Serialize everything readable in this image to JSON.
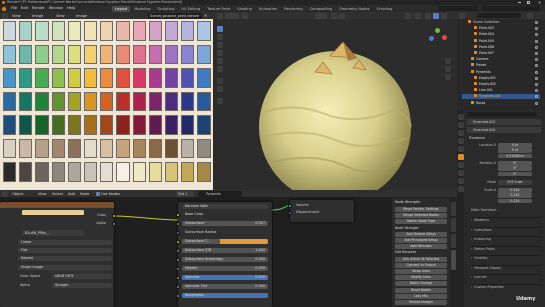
{
  "titlebar": {
    "title": "Blender* [PC Professional\\PC Content Works\\Concave\\Miniature Egyptian Planet\\Miniature Egyptian Planet.blend]"
  },
  "menu": {
    "items": [
      "File",
      "Edit",
      "Render",
      "Window",
      "Help"
    ]
  },
  "workspace_tabs": {
    "items": [
      "Layout",
      "Modeling",
      "Sculpting",
      "UV Editing",
      "Texture Paint",
      "Shading",
      "Animation",
      "Rendering",
      "Compositing",
      "Geometry Nodes",
      "Scripting"
    ],
    "active_index": 0
  },
  "image_editor": {
    "header": {
      "view": "View",
      "image": "Image",
      "view2": "View",
      "image_name": "Sunset_gouache_paint_texture"
    },
    "swatch_colors": [
      [
        "#c9d9df",
        "#a7d0c6",
        "#b9ddc9",
        "#cfe3bf",
        "#e8eab8",
        "#f2e3b3",
        "#f1d2b0",
        "#ecb7ab",
        "#e7a7b6",
        "#d3a4c8",
        "#c2a9d7",
        "#b4b5df",
        "#a9c7e4"
      ],
      [
        "#8ec3d9",
        "#6fb7aa",
        "#8fcd8f",
        "#b2d68b",
        "#ddde7c",
        "#f2d071",
        "#f1b276",
        "#e98b78",
        "#e07291",
        "#c56fae",
        "#9f73c2",
        "#8885cd",
        "#7aa6d8"
      ],
      [
        "#4a95c7",
        "#2e9a86",
        "#46ad55",
        "#8bc14c",
        "#cfcd3e",
        "#f2bb38",
        "#ee8a3c",
        "#e0513e",
        "#d63964",
        "#a83b8f",
        "#7342a5",
        "#5152af",
        "#3f7bc4"
      ],
      [
        "#2a6aa0",
        "#167566",
        "#1f843a",
        "#5f952c",
        "#a8a224",
        "#d99523",
        "#d46322",
        "#b8302a",
        "#ac224a",
        "#7c246d",
        "#4e2d80",
        "#2f3888",
        "#275a9c"
      ],
      [
        "#1f4d7a",
        "#0f574b",
        "#15622b",
        "#446d20",
        "#7c771b",
        "#a86e1a",
        "#a2481a",
        "#8a221f",
        "#831938",
        "#5d1b52",
        "#3a2161",
        "#222a66",
        "#1c4276"
      ],
      [
        "#d8cfc4",
        "#c9b9a6",
        "#b5a08a",
        "#a2876f",
        "#8d705a",
        "#e6dbc8",
        "#d6c0a0",
        "#c3a47b",
        "#a8865d",
        "#8a6a46",
        "#6c5235",
        "#b8b2a8",
        "#8f8a82"
      ],
      [
        "#2c2a28",
        "#4a4642",
        "#6b6560",
        "#8c857e",
        "#aea69e",
        "#c9c2ba",
        "#e3ddd6",
        "#f4efe8",
        "#f0e9c8",
        "#e7da9e",
        "#d8c37a",
        "#c2a85b",
        "#a48a45"
      ]
    ]
  },
  "viewport": {
    "header": {
      "mode": "Object Mode",
      "view": "View",
      "select": "Select",
      "add": "Add",
      "object": "Object",
      "orientation": "Global"
    }
  },
  "node_editor": {
    "header": {
      "items": [
        "Object",
        "View",
        "Select",
        "Add",
        "Node"
      ],
      "use_nodes": "Use Nodes",
      "slot": "Slot 1",
      "material": "Pyramids"
    },
    "image_node": {
      "output_color": "Color",
      "output_alpha": "Alpha",
      "image_name": "81u4N_PPbs_..",
      "interp": "Linear",
      "proj": "Flat",
      "ext": "Repeat",
      "source": "Single Image",
      "cs_label": "Color Space",
      "cs_value": "sRGB OETF",
      "alpha_label": "Alpha",
      "alpha_value": "Straight"
    },
    "bsdf_node": {
      "subsurface_method": "Random Walk",
      "rows": [
        {
          "label": "Base Color",
          "value": "",
          "style": "socket"
        },
        {
          "label": "Subsurface",
          "value": "0.027",
          "style": "field"
        },
        {
          "label": "Subsurface Radius",
          "value": "",
          "style": "socket"
        },
        {
          "label": "Subsurface C...",
          "value": "",
          "style": "color"
        },
        {
          "label": "Subsurface IOR",
          "value": "1.400",
          "style": "field"
        },
        {
          "label": "Subsurface Anisotropy",
          "value": "0.000",
          "style": "field"
        },
        {
          "label": "Metallic",
          "value": "0.000",
          "style": "field"
        },
        {
          "label": "Specular",
          "value": "0.500",
          "style": "blue"
        },
        {
          "label": "Specular Tint",
          "value": "0.000",
          "style": "field"
        },
        {
          "label": "Roughness",
          "value": "",
          "style": "blue"
        }
      ]
    },
    "output_node": {
      "volume": "Volume",
      "displacement": "Displacement"
    },
    "node_wrangler": {
      "title": "Node Wrangler",
      "items": [
        "Bevel Render Settings",
        "Merge Selected Nodes",
        "Switch Node Type",
        "Node Wrangler",
        "Add Texture Setup",
        "Add Principled Setup",
        "Add Reroutes",
        "Edit Reroutes",
        "Link Active To Selected",
        "Connect to Output",
        "Swap Links",
        "Modify Links",
        "Batch Change",
        "Reset Nodes",
        "Lazy Mix",
        "Reload Images"
      ]
    }
  },
  "outliner": {
    "rows": [
      {
        "indent": 2,
        "label": "Scene Collection",
        "color": "#cfcfcf"
      },
      {
        "indent": 4,
        "label": "Point.003",
        "color": "#e6e6e6"
      },
      {
        "indent": 4,
        "label": "Point.004",
        "color": "#e6e6e6"
      },
      {
        "indent": 4,
        "label": "Point.005",
        "color": "#e6e6e6"
      },
      {
        "indent": 4,
        "label": "Point.006",
        "color": "#e6e6e6"
      },
      {
        "indent": 4,
        "label": "Point.007",
        "color": "#e6e6e6"
      },
      {
        "indent": 3,
        "label": "Camera",
        "color": "#e6e6e6"
      },
      {
        "indent": 3,
        "label": "Planet",
        "color": "#e6e6e6"
      },
      {
        "indent": 3,
        "label": "Pyramids",
        "color": "#e6e6e6"
      },
      {
        "indent": 4,
        "label": "Empty.001",
        "color": "#e6e6e6"
      },
      {
        "indent": 4,
        "label": "Empty.002",
        "color": "#e6e6e6"
      },
      {
        "indent": 4,
        "label": "Line.001",
        "color": "#e6e6e6"
      },
      {
        "indent": 4,
        "label": "Pyramids.001",
        "color": "#ffaf29"
      },
      {
        "indent": 3,
        "label": "Rocks",
        "color": "#e6e6e6"
      }
    ],
    "selected_index": 12
  },
  "properties": {
    "object_name": "Pyramids.001",
    "object_name2": "Pyramids.001",
    "transform_label": "Transform",
    "location": {
      "label": "Location X",
      "x": "0 m",
      "y": "0 m",
      "z": "0.31028 m"
    },
    "rotation": {
      "label": "Rotation X",
      "x": "0°",
      "y": "0°",
      "z": "0°"
    },
    "mode": {
      "label": "Mode",
      "value": "XYZ Euler"
    },
    "scale": {
      "label": "Scale X",
      "x": "0.224",
      "y": "0.224",
      "z": "0.224"
    },
    "delta_transform": "Delta Transform",
    "sections": [
      "Relations",
      "Collections",
      "Instancing",
      "Motion Paths",
      "Visibility",
      "Viewport Display",
      "Line Art",
      "Custom Properties"
    ]
  },
  "watermark": "Udemy"
}
